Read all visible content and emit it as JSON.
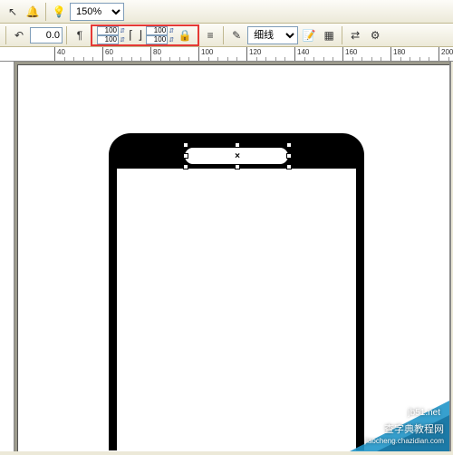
{
  "toolbar": {
    "zoom_value": "150%",
    "rotation": "0.0",
    "outline_label": "细线",
    "scale_group": {
      "h1": "100",
      "h2": "100",
      "v1": "100",
      "v2": "100"
    }
  },
  "ruler": {
    "ticks": [
      "40",
      "60",
      "80",
      "100",
      "120",
      "140",
      "160",
      "180",
      "200"
    ]
  },
  "icons": {
    "pointer": "↖",
    "bell": "🔔",
    "bulb": "💡",
    "undo": "↶",
    "paragraph": "¶",
    "lock": "🔒",
    "align": "≡",
    "pen": "✎",
    "edit": "📝",
    "grid": "▦",
    "swap": "⇄",
    "gear": "⚙"
  },
  "watermark": {
    "line1": "查字典教程网",
    "line2": "jiaocheng.chazidian.com",
    "badge": "jb51.net"
  }
}
